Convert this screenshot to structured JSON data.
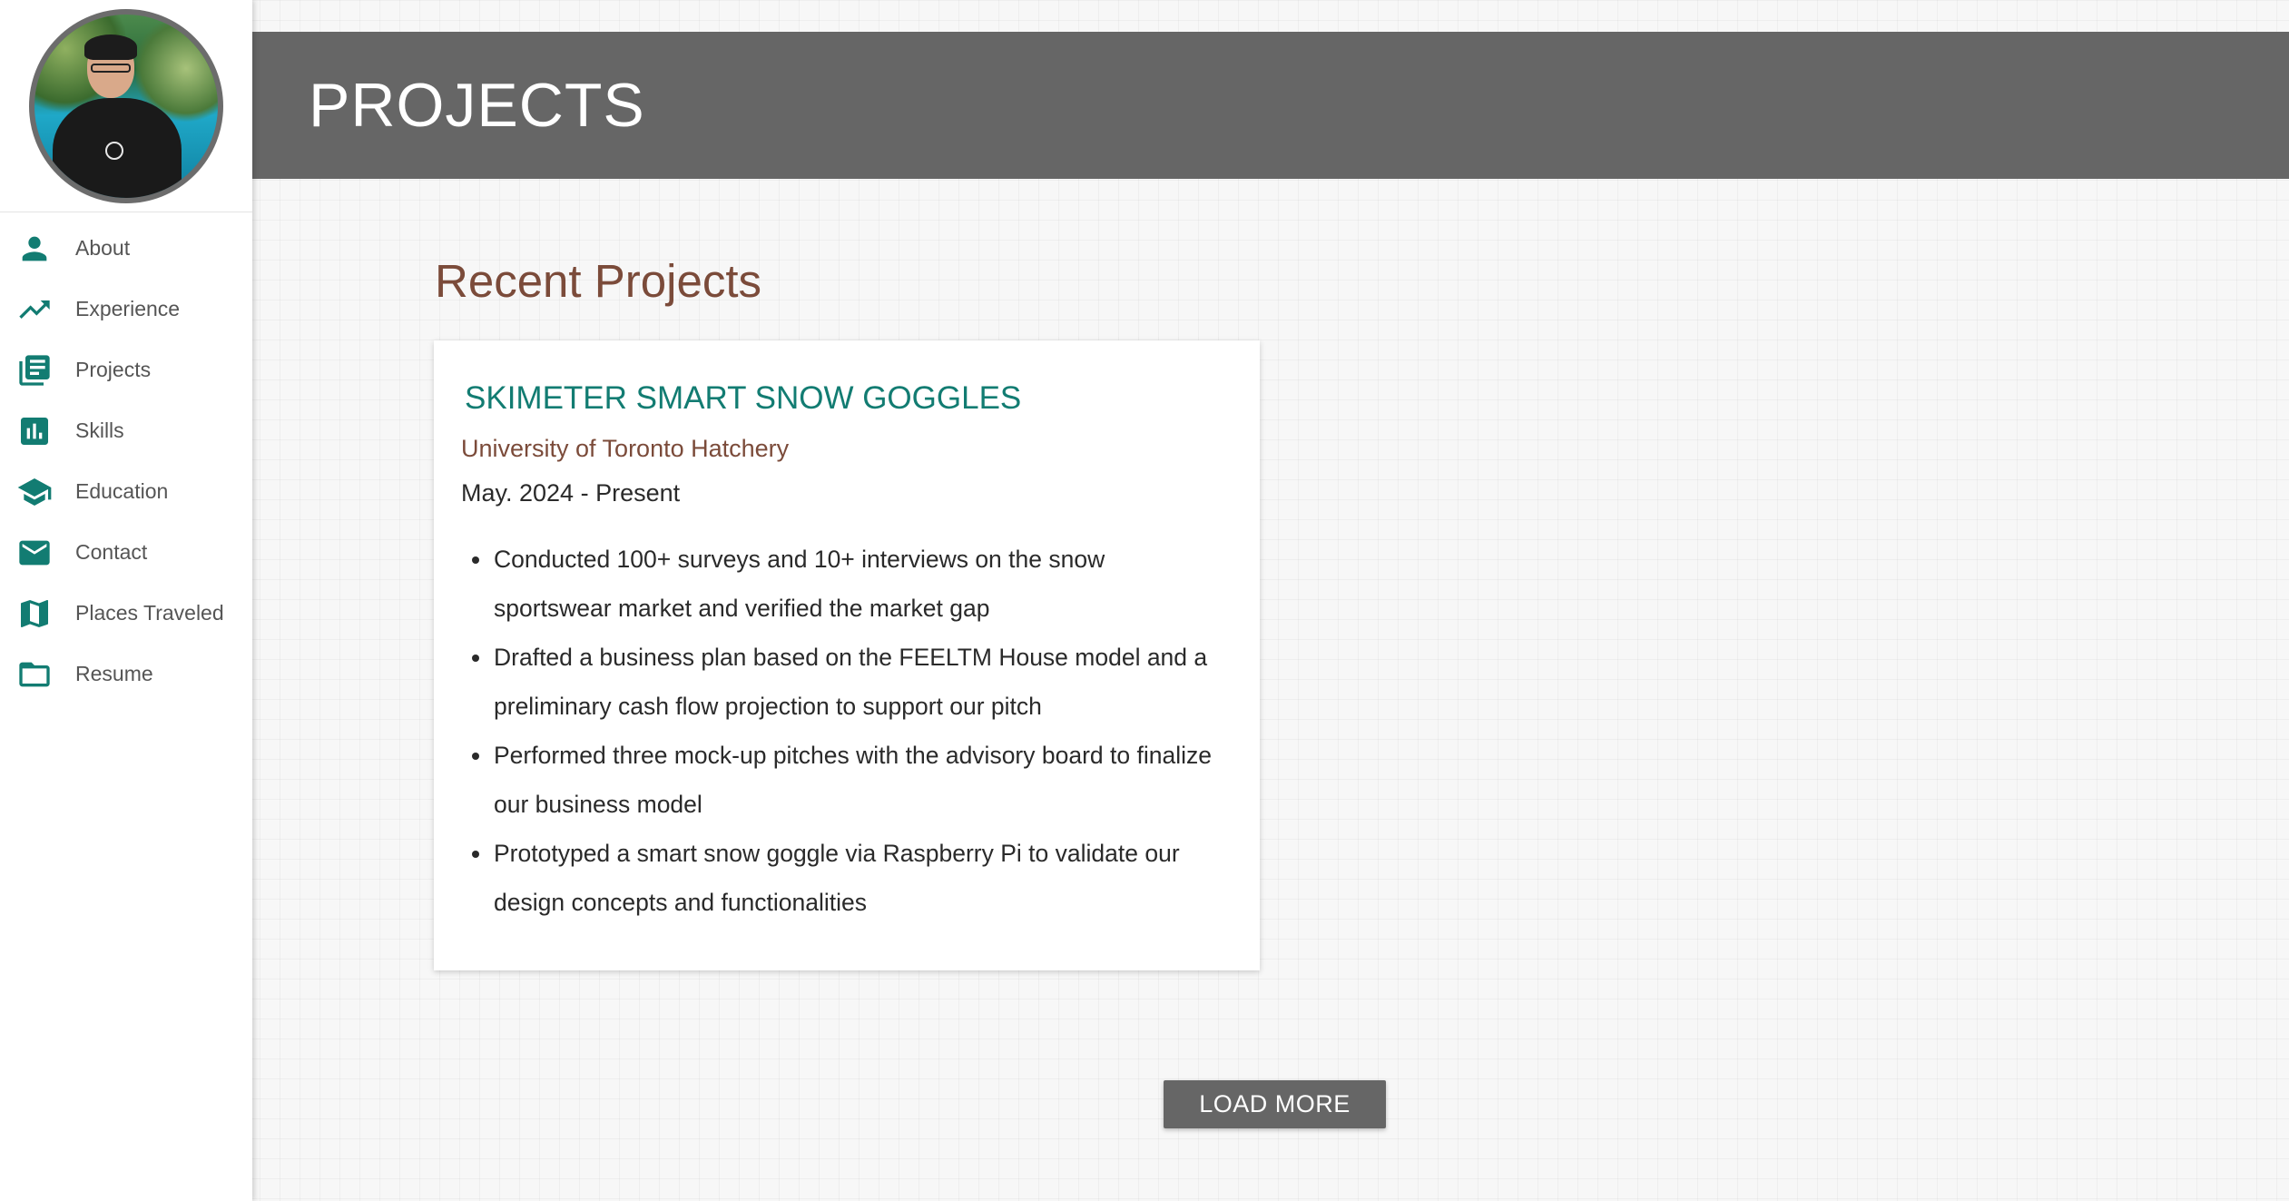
{
  "sidebar": {
    "items": [
      {
        "label": "About",
        "icon": "person-icon"
      },
      {
        "label": "Experience",
        "icon": "trending-up-icon"
      },
      {
        "label": "Projects",
        "icon": "library-books-icon"
      },
      {
        "label": "Skills",
        "icon": "bar-chart-icon"
      },
      {
        "label": "Education",
        "icon": "school-icon"
      },
      {
        "label": "Contact",
        "icon": "mail-icon"
      },
      {
        "label": "Places Traveled",
        "icon": "map-icon"
      },
      {
        "label": "Resume",
        "icon": "folder-icon"
      }
    ]
  },
  "header": {
    "title": "PROJECTS"
  },
  "main": {
    "section_title": "Recent Projects",
    "project": {
      "title": "SKIMETER SMART SNOW GOGGLES",
      "organization": "University of Toronto Hatchery",
      "date": "May. 2024 - Present",
      "bullets": [
        "Conducted 100+ surveys and 10+ interviews on the snow sportswear market and verified the market gap",
        "Drafted a business plan based on the FEELTM House model and a preliminary cash flow projection to support our pitch",
        "Performed three mock-up pitches with the advisory board to finalize our business model",
        "Prototyped a smart snow goggle via Raspberry Pi to validate our design concepts and functionalities"
      ]
    },
    "load_more_label": "LOAD MORE"
  },
  "colors": {
    "accent": "#127c72",
    "header_bg": "#666666",
    "title_brown": "#7b4b3a",
    "button_bg": "#666666"
  }
}
